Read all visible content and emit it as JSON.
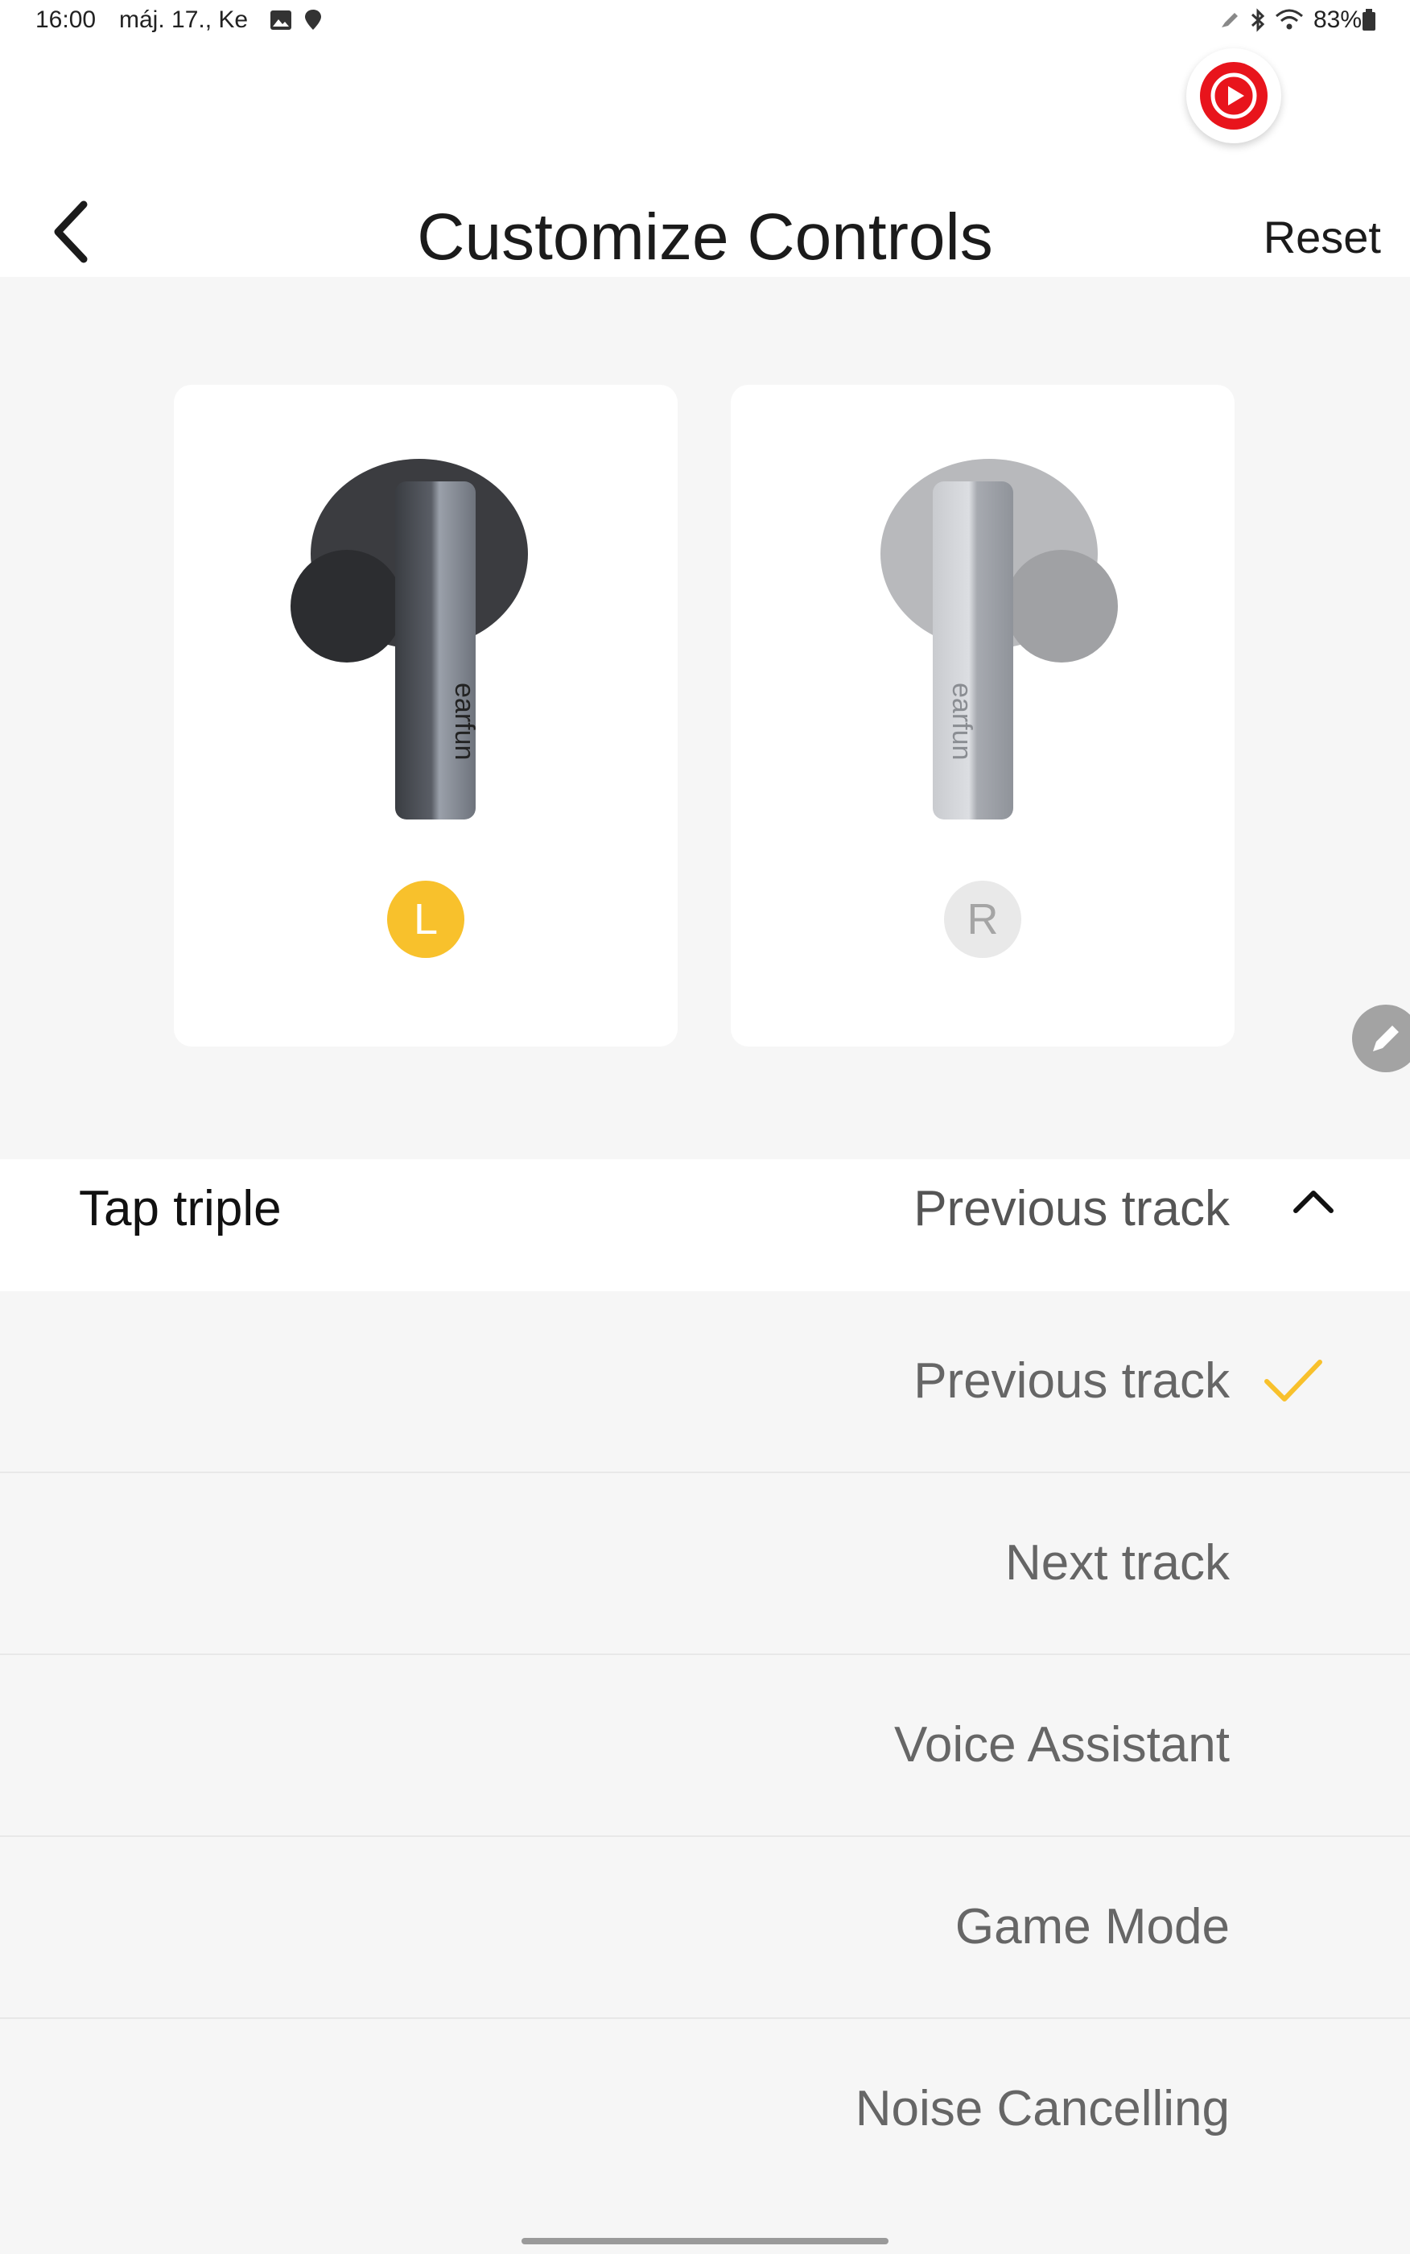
{
  "status_bar": {
    "time": "16:00",
    "date": "máj. 17., Ke",
    "battery": "83%",
    "icons": [
      "image-icon",
      "location-icon",
      "pen-icon",
      "bluetooth-icon",
      "wifi-icon",
      "battery-icon"
    ]
  },
  "header": {
    "title": "Customize Controls",
    "reset_label": "Reset",
    "back_icon": "chevron-left-icon",
    "floating_icon": "play-circle-icon"
  },
  "earbuds": {
    "left": {
      "badge": "L",
      "brand": "earfun",
      "selected": true
    },
    "right": {
      "badge": "R",
      "brand": "earfun",
      "selected": false
    },
    "edit_icon": "pencil-icon"
  },
  "control": {
    "label": "Tap triple",
    "value": "Previous track",
    "expanded": true
  },
  "options": [
    {
      "label": "Previous track",
      "selected": true
    },
    {
      "label": "Next track",
      "selected": false
    },
    {
      "label": "Voice Assistant",
      "selected": false
    },
    {
      "label": "Game Mode",
      "selected": false
    },
    {
      "label": "Noise Cancelling",
      "selected": false
    }
  ],
  "colors": {
    "accent": "#f8c12c",
    "floating_button": "#e8141c"
  }
}
